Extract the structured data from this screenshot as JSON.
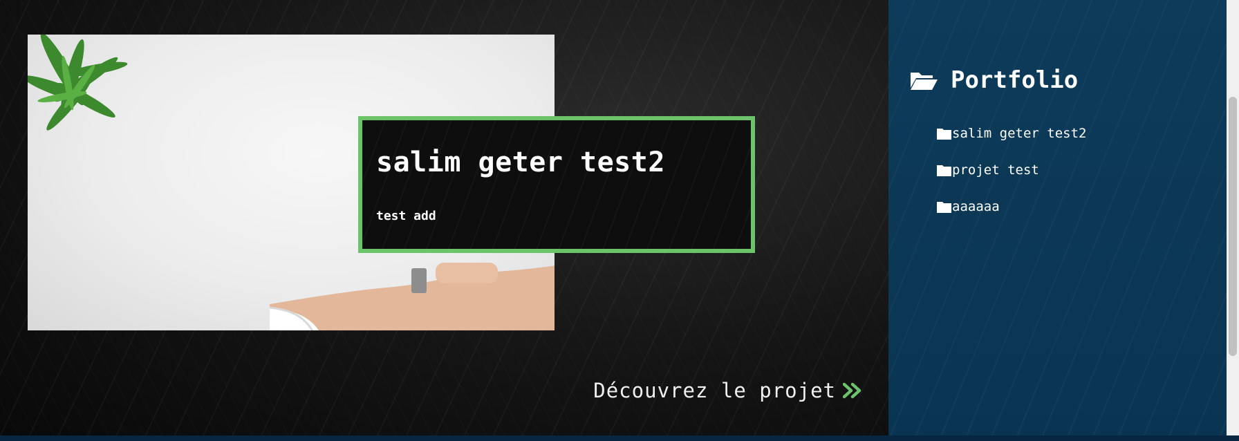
{
  "project": {
    "title": "salim geter test2",
    "subtitle": "test add",
    "cta_label": "Découvrez le projet"
  },
  "sidebar": {
    "title": "Portfolio",
    "items": [
      {
        "label": "salim geter test2"
      },
      {
        "label": "projet test"
      },
      {
        "label": "aaaaaa"
      }
    ]
  },
  "colors": {
    "accent": "#6cc36c",
    "sidebar_bg": "#0d3b59",
    "main_bg": "#141414"
  },
  "icons": [
    "folder-open-icon",
    "folder-icon",
    "double-chevron-right-icon"
  ]
}
